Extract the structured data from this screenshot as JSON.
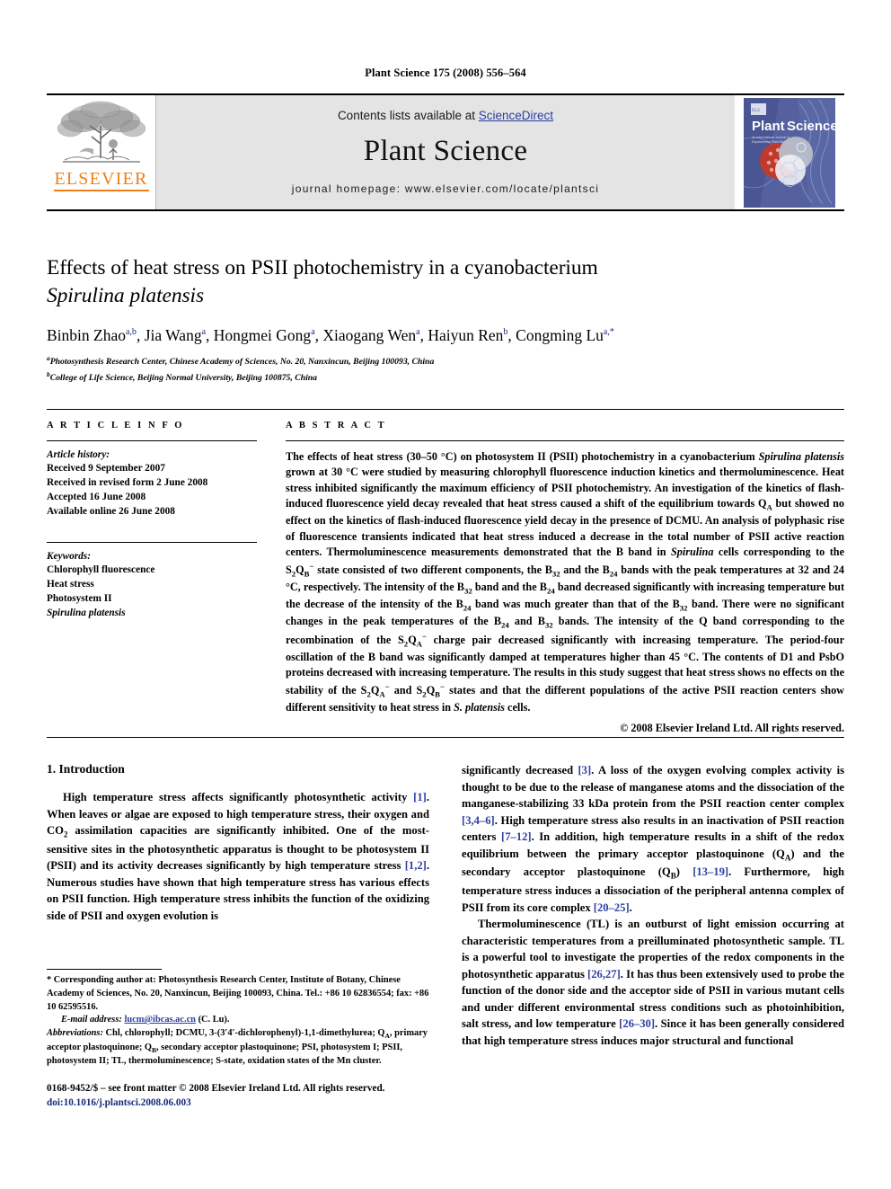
{
  "running_head": "Plant Science 175 (2008) 556–564",
  "masthead": {
    "publisher_name": "ELSEVIER",
    "contents_prefix": "Contents lists available at ",
    "contents_link": "ScienceDirect",
    "journal_title": "Plant Science",
    "homepage": "journal homepage: www.elsevier.com/locate/plantsci",
    "cover_title": "Plant Science",
    "cover_subtitle": "An International Journal of Experimental Plant Biology",
    "link_color": "#2b3fa0",
    "brand_color": "#f07f1a",
    "band_color": "#e4e4e4"
  },
  "article": {
    "title_line1": "Effects of heat stress on PSII photochemistry in a cyanobacterium",
    "title_line2": "Spirulina platensis",
    "authors": [
      {
        "name": "Binbin Zhao",
        "marks": "a,b"
      },
      {
        "name": "Jia Wang",
        "marks": "a"
      },
      {
        "name": "Hongmei Gong",
        "marks": "a"
      },
      {
        "name": "Xiaogang Wen",
        "marks": "a"
      },
      {
        "name": "Haiyun Ren",
        "marks": "b"
      },
      {
        "name": "Congming Lu",
        "marks": "a,*"
      }
    ],
    "affiliations": [
      {
        "mark": "a",
        "text": "Photosynthesis Research Center, Chinese Academy of Sciences, No. 20, Nanxincun, Beijing 100093, China"
      },
      {
        "mark": "b",
        "text": "College of Life Science, Beijing Normal University, Beijing 100875, China"
      }
    ]
  },
  "article_info": {
    "heading": "A R T I C L E  I N F O",
    "history_heading": "Article history:",
    "history": [
      "Received 9 September 2007",
      "Received in revised form 2 June 2008",
      "Accepted 16 June 2008",
      "Available online 26 June 2008"
    ],
    "keywords_heading": "Keywords:",
    "keywords": [
      "Chlorophyll fluorescence",
      "Heat stress",
      "Photosystem II",
      "Spirulina platensis"
    ]
  },
  "abstract": {
    "heading": "A B S T R A C T",
    "paragraph_1": "The effects of heat stress (30–50 °C) on photosystem II (PSII) photochemistry in a cyanobacterium ",
    "species_1": "Spirulina platensis",
    "paragraph_2": " grown at 30 °C were studied by measuring chlorophyll fluorescence induction kinetics and thermoluminescence. Heat stress inhibited significantly the maximum efficiency of PSII photochemistry. An investigation of the kinetics of flash-induced fluorescence yield decay revealed that heat stress caused a shift of the equilibrium towards Q",
    "sub_a": "A",
    "paragraph_3": " but showed no effect on the kinetics of flash-induced fluorescence yield decay in the presence of DCMU. An analysis of polyphasic rise of fluorescence transients indicated that heat stress induced a decrease in the total number of PSII active reaction centers. Thermoluminescence measurements demonstrated that the B band in ",
    "species_2": "Spirulina",
    "paragraph_4": " cells corresponding to the S",
    "paragraph_5": " state consisted of two different components, the B",
    "paragraph_6": " and the B",
    "paragraph_7": " bands with the peak temperatures at 32 and 24 °C, respectively. The intensity of the B",
    "paragraph_8": " band and the B",
    "paragraph_9": " band decreased significantly with increasing temperature but the decrease of the intensity of the B",
    "paragraph_10": " band was much greater than that of the B",
    "paragraph_11": " band. There were no significant changes in the peak temperatures of the B",
    "paragraph_12": " and B",
    "paragraph_13": " bands. The intensity of the Q band corresponding to the recombination of the S",
    "paragraph_14": " charge pair decreased significantly with increasing temperature. The period-four oscillation of the B band was significantly damped at temperatures higher than 45 °C. The contents of D1 and PsbO proteins decreased with increasing temperature. The results in this study suggest that heat stress shows no effects on the stability of the S",
    "paragraph_15": " and S",
    "paragraph_16": " states and that the different populations of the active PSII reaction centers show different sensitivity to heat stress in ",
    "species_3": "S. platensis",
    "paragraph_17": " cells.",
    "copyright": "© 2008 Elsevier Ireland Ltd. All rights reserved."
  },
  "introduction": {
    "heading": "1. Introduction",
    "left_p1_a": "High temperature stress affects significantly photosynthetic activity ",
    "left_p1_ref1": "[1]",
    "left_p1_b": ". When leaves or algae are exposed to high temperature stress, their oxygen and CO",
    "left_p1_c": " assimilation capacities are significantly inhibited. One of the most-sensitive sites in the photosynthetic apparatus is thought to be photosystem II (PSII) and its activity decreases significantly by high temperature stress ",
    "left_p1_ref2": "[1,2]",
    "left_p1_d": ". Numerous studies have shown that high temperature stress has various effects on PSII function. High temperature stress inhibits the function of the oxidizing side of PSII and oxygen evolution is",
    "right_p1_a": "significantly decreased ",
    "right_p1_ref1": "[3]",
    "right_p1_b": ". A loss of the oxygen evolving complex activity is thought to be due to the release of manganese atoms and the dissociation of the manganese-stabilizing 33 kDa protein from the PSII reaction center complex ",
    "right_p1_ref2": "[3,4–6]",
    "right_p1_c": ". High temperature stress also results in an inactivation of PSII reaction centers ",
    "right_p1_ref3": "[7–12]",
    "right_p1_d": ". In addition, high temperature results in a shift of the redox equilibrium between the primary acceptor plastoquinone (Q",
    "right_p1_e": ") and the secondary acceptor plastoquinone (Q",
    "right_p1_f": ") ",
    "right_p1_ref4": "[13–19]",
    "right_p1_g": ". Furthermore, high temperature stress induces a dissociation of the peripheral antenna complex of PSII from its core complex ",
    "right_p1_ref5": "[20–25]",
    "right_p1_h": ".",
    "right_p2_a": "Thermoluminescence (TL) is an outburst of light emission occurring at characteristic temperatures from a preilluminated photosynthetic sample. TL is a powerful tool to investigate the properties of the redox components in the photosynthetic apparatus ",
    "right_p2_ref1": "[26,27]",
    "right_p2_b": ". It has thus been extensively used to probe the function of the donor side and the acceptor side of PSII in various mutant cells and under different environmental stress conditions such as photoinhibition, salt stress, and low temperature ",
    "right_p2_ref2": "[26–30]",
    "right_p2_c": ". Since it has been generally considered that high temperature stress induces major structural and functional"
  },
  "footnote": {
    "corresponding": "* Corresponding author at: Photosynthesis Research Center, Institute of Botany, Chinese Academy of Sciences, No. 20, Nanxincun, Beijing 100093, China. Tel.: +86 10 62836554; fax: +86 10 62595516.",
    "email_label": "E-mail address:",
    "email": "lucm@ibcas.ac.cn",
    "email_suffix": " (C. Lu).",
    "abbrev_label": "Abbreviations:",
    "abbrev_text": " Chl, chlorophyll; DCMU, 3-(3′4′-dichlorophenyl)-1,1-dimethylurea; Q"
  },
  "abbreviations_rest": {
    "t1": ", primary acceptor plastoquinone; Q",
    "t2": ", secondary acceptor plastoquinone; PSI, photosystem I; PSII, photosystem II; TL, thermoluminescence; S-state, oxidation states of the Mn cluster."
  },
  "imprint": {
    "line1": "0168-9452/$ – see front matter © 2008 Elsevier Ireland Ltd. All rights reserved.",
    "line2": "doi:10.1016/j.plantsci.2008.06.003"
  }
}
